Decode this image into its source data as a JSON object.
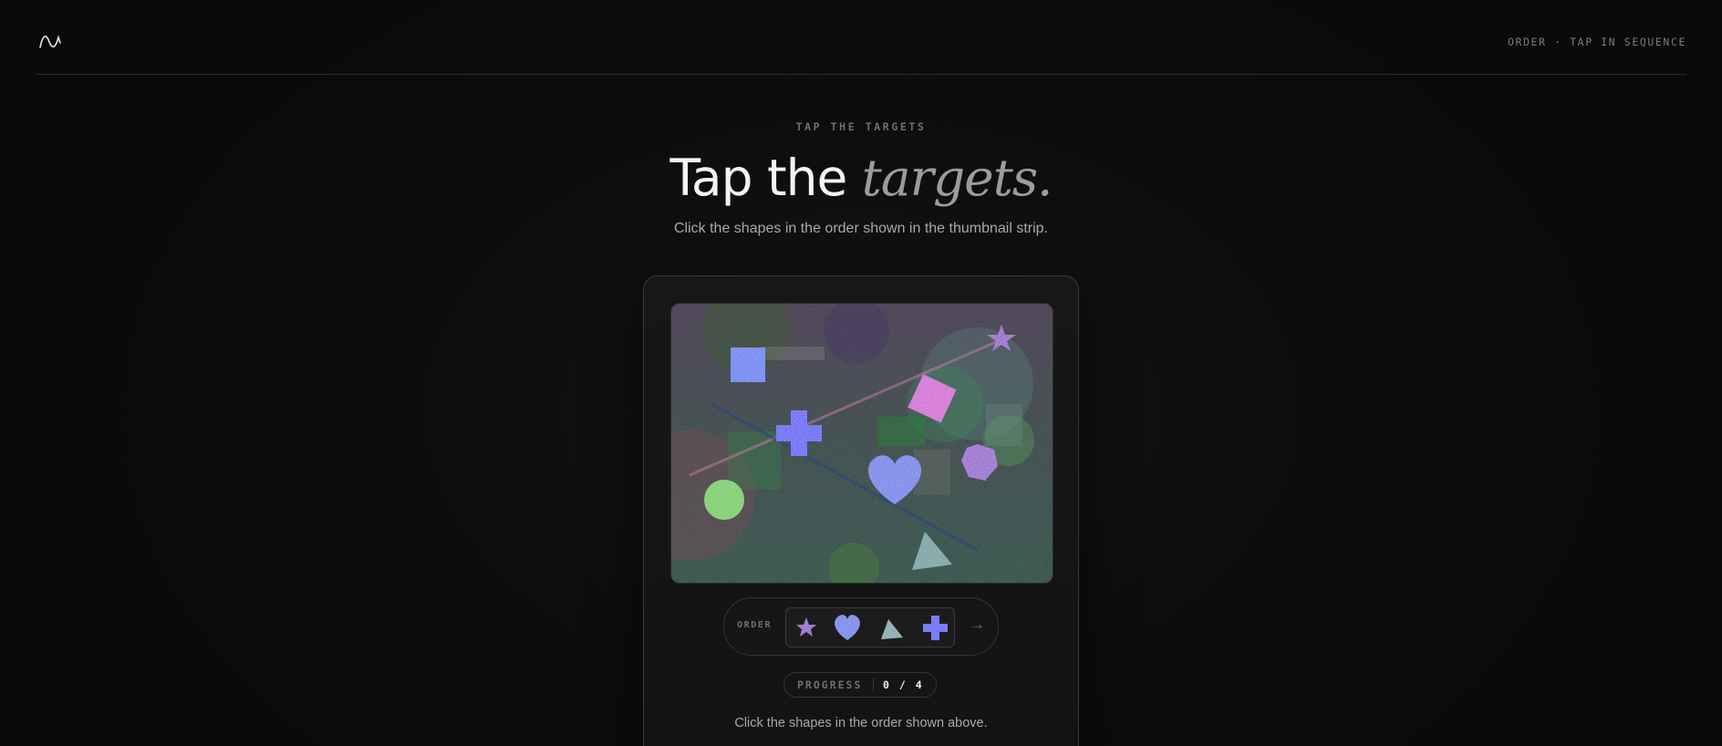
{
  "header": {
    "logo_icon": "wave-logo-icon",
    "right_text": "ORDER · TAP IN SEQUENCE"
  },
  "hero": {
    "eyebrow": "TAP THE TARGETS",
    "title_main": "Tap the ",
    "title_accent": "targets.",
    "subtitle": "Click the shapes in the order shown in the thumbnail strip."
  },
  "canvas": {
    "targets": [
      {
        "name": "star",
        "color": "#8a3fc0"
      },
      {
        "name": "square",
        "color": "#4a6df0"
      },
      {
        "name": "diamond",
        "color": "#d04ad0"
      },
      {
        "name": "cross",
        "color": "#3a3cf5"
      },
      {
        "name": "heart",
        "color": "#5a70e6"
      },
      {
        "name": "hexagon",
        "color": "#8a4bc8"
      },
      {
        "name": "circle",
        "color": "#5ec82a"
      },
      {
        "name": "triangle",
        "color": "#6aa0a0"
      }
    ]
  },
  "order": {
    "label": "ORDER",
    "sequence": [
      "star-icon",
      "heart-icon",
      "triangle-icon",
      "cross-icon"
    ],
    "next_icon": "→"
  },
  "progress": {
    "label": "PROGRESS",
    "count": "0 / 4"
  },
  "instructions": "Click the shapes in the order shown above."
}
